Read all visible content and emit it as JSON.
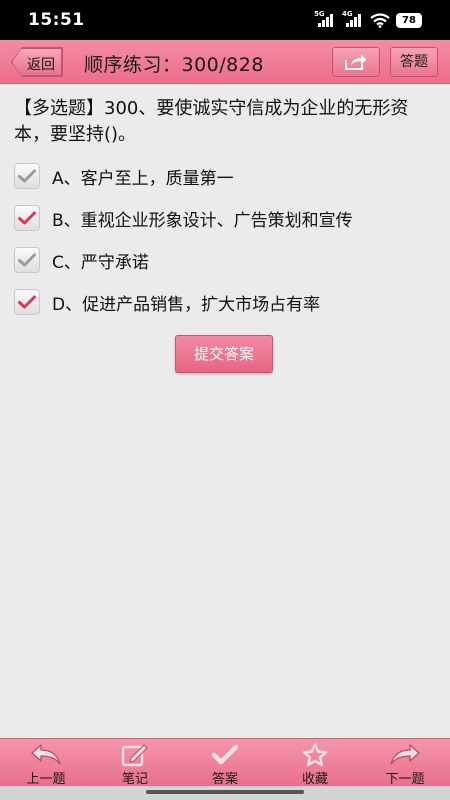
{
  "status_bar": {
    "time": "15:51",
    "network_1": "5G",
    "network_2": "4G",
    "battery": "78"
  },
  "header": {
    "back_label": "返回",
    "title": "顺序练习：300/828",
    "answer_sheet_label": "答题",
    "share_icon": "share-icon"
  },
  "question": {
    "text": "【多选题】300、要使诚实守信成为企业的无形资本，要坚持()。",
    "options": [
      {
        "label": "A、客户至上，质量第一",
        "checked": false
      },
      {
        "label": "B、重视企业形象设计、广告策划和宣传",
        "checked": true
      },
      {
        "label": "C、严守承诺",
        "checked": false
      },
      {
        "label": "D、促进产品销售，扩大市场占有率",
        "checked": true
      }
    ]
  },
  "submit_label": "提交答案",
  "toolbar": {
    "items": [
      {
        "label": "上一题",
        "icon": "back-arrow-icon"
      },
      {
        "label": "笔记",
        "icon": "edit-note-icon"
      },
      {
        "label": "答案",
        "icon": "checkmark-icon"
      },
      {
        "label": "收藏",
        "icon": "star-icon"
      },
      {
        "label": "下一题",
        "icon": "forward-arrow-icon"
      }
    ]
  },
  "colors": {
    "accent": "#ec6e8b",
    "check_selected": "#e0345a",
    "check_unselected": "#9a9a9a",
    "background": "#ebebeb"
  }
}
